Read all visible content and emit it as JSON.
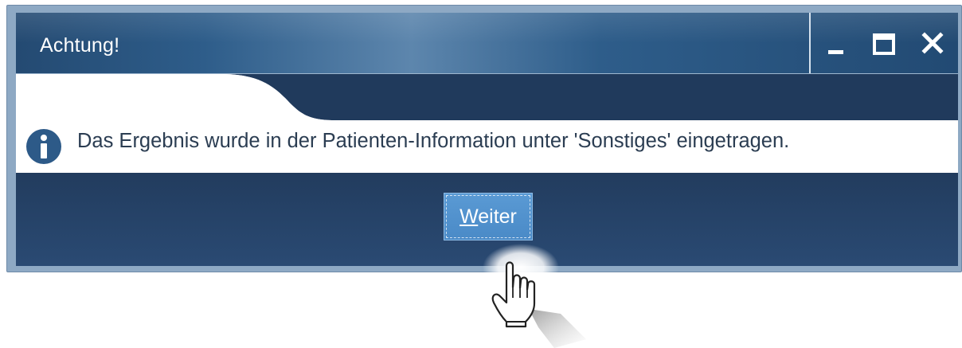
{
  "window": {
    "title": "Achtung!",
    "controls": {
      "minimize_icon": "minimize-icon",
      "maximize_icon": "maximize-icon",
      "close_icon": "close-icon"
    }
  },
  "dialog": {
    "icon": "info-icon",
    "message": "Das Ergebnis wurde in der Patienten-Information unter 'Sonstiges' eingetragen.",
    "button": {
      "mnemonic": "W",
      "label_rest": "eiter"
    }
  },
  "cursor": "hand-pointer-icon",
  "colors": {
    "titlebar": "#2e5d8a",
    "body": "#233f62",
    "button": "#4a8ac7",
    "text": "#2b3d52",
    "frame": "#8ea9c4"
  }
}
